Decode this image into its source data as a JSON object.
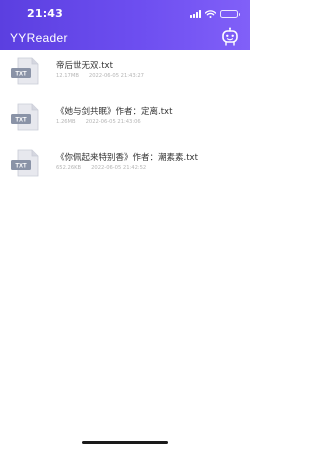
{
  "status_bar": {
    "time": "21:43",
    "icons": [
      "signal-icon",
      "wifi-icon",
      "battery-icon"
    ]
  },
  "header": {
    "title": "YYReader",
    "right_icon": "robot-icon",
    "gradient": [
      "#5b3fe0",
      "#8160f8"
    ]
  },
  "files": [
    {
      "name": "帝后世无双.txt",
      "size": "12.17MB",
      "date": "2022-06-05 21:43:27",
      "icon_label": "TXT"
    },
    {
      "name": "《她与剑共眠》作者：定离.txt",
      "size": "1.26MB",
      "date": "2022-06-05 21:43:06",
      "icon_label": "TXT"
    },
    {
      "name": "《你佩起来特别香》作者：潮素素.txt",
      "size": "652.26KB",
      "date": "2022-06-05 21:42:52",
      "icon_label": "TXT"
    }
  ]
}
